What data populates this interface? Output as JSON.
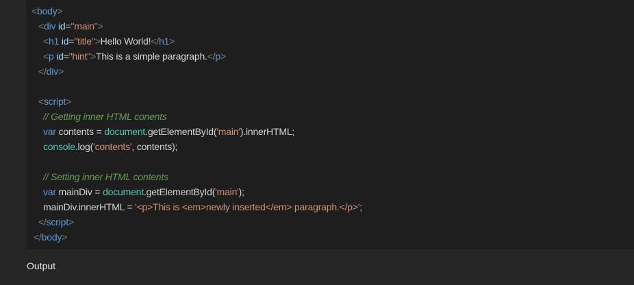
{
  "code": {
    "lines": [
      {
        "indent": "indent-0",
        "tokens": [
          {
            "t": "<",
            "c": "tk-punct"
          },
          {
            "t": "body",
            "c": "tk-tag"
          },
          {
            "t": ">",
            "c": "tk-punct"
          }
        ]
      },
      {
        "indent": "indent-1",
        "tokens": [
          {
            "t": "<",
            "c": "tk-punct"
          },
          {
            "t": "div",
            "c": "tk-tag"
          },
          {
            "t": " ",
            "c": "tk-plain"
          },
          {
            "t": "id",
            "c": "tk-attr"
          },
          {
            "t": "=",
            "c": "tk-text"
          },
          {
            "t": "\"main\"",
            "c": "tk-str"
          },
          {
            "t": ">",
            "c": "tk-punct"
          }
        ]
      },
      {
        "indent": "indent-2",
        "tokens": [
          {
            "t": "<",
            "c": "tk-punct"
          },
          {
            "t": "h1",
            "c": "tk-tag"
          },
          {
            "t": " ",
            "c": "tk-plain"
          },
          {
            "t": "id",
            "c": "tk-attr"
          },
          {
            "t": "=",
            "c": "tk-text"
          },
          {
            "t": "\"title\"",
            "c": "tk-str"
          },
          {
            "t": ">",
            "c": "tk-punct"
          },
          {
            "t": "Hello World!",
            "c": "tk-text"
          },
          {
            "t": "</",
            "c": "tk-punct"
          },
          {
            "t": "h1",
            "c": "tk-tag"
          },
          {
            "t": ">",
            "c": "tk-punct"
          }
        ]
      },
      {
        "indent": "indent-2",
        "tokens": [
          {
            "t": "<",
            "c": "tk-punct"
          },
          {
            "t": "p",
            "c": "tk-tag"
          },
          {
            "t": " ",
            "c": "tk-plain"
          },
          {
            "t": "id",
            "c": "tk-attr"
          },
          {
            "t": "=",
            "c": "tk-text"
          },
          {
            "t": "\"hint\"",
            "c": "tk-str"
          },
          {
            "t": ">",
            "c": "tk-punct"
          },
          {
            "t": "This is a simple paragraph.",
            "c": "tk-text"
          },
          {
            "t": "</",
            "c": "tk-punct"
          },
          {
            "t": "p",
            "c": "tk-tag"
          },
          {
            "t": ">",
            "c": "tk-punct"
          }
        ]
      },
      {
        "indent": "indent-1",
        "tokens": [
          {
            "t": "</",
            "c": "tk-punct"
          },
          {
            "t": "div",
            "c": "tk-tag"
          },
          {
            "t": ">",
            "c": "tk-punct"
          }
        ]
      },
      {
        "indent": "indent-1",
        "tokens": []
      },
      {
        "indent": "indent-1",
        "tokens": [
          {
            "t": "<",
            "c": "tk-punct"
          },
          {
            "t": "script",
            "c": "tk-tag"
          },
          {
            "t": ">",
            "c": "tk-punct"
          }
        ]
      },
      {
        "indent": "indent-2",
        "tokens": [
          {
            "t": "// Getting inner HTML conents",
            "c": "tk-comment"
          }
        ]
      },
      {
        "indent": "indent-2",
        "tokens": [
          {
            "t": "var",
            "c": "tk-kw"
          },
          {
            "t": " contents = ",
            "c": "tk-plain"
          },
          {
            "t": "document",
            "c": "tk-obj"
          },
          {
            "t": ".getElementById(",
            "c": "tk-plain"
          },
          {
            "t": "'main'",
            "c": "tk-str"
          },
          {
            "t": ").innerHTML;",
            "c": "tk-plain"
          }
        ]
      },
      {
        "indent": "indent-2",
        "tokens": [
          {
            "t": "console",
            "c": "tk-obj"
          },
          {
            "t": ".log(",
            "c": "tk-plain"
          },
          {
            "t": "'contents'",
            "c": "tk-str"
          },
          {
            "t": ", contents);",
            "c": "tk-plain"
          }
        ]
      },
      {
        "indent": "indent-2",
        "tokens": []
      },
      {
        "indent": "indent-2",
        "tokens": [
          {
            "t": "// Setting inner HTML contents",
            "c": "tk-comment"
          }
        ]
      },
      {
        "indent": "indent-2",
        "tokens": [
          {
            "t": "var",
            "c": "tk-kw"
          },
          {
            "t": " mainDiv = ",
            "c": "tk-plain"
          },
          {
            "t": "document",
            "c": "tk-obj"
          },
          {
            "t": ".getElementById(",
            "c": "tk-plain"
          },
          {
            "t": "'main'",
            "c": "tk-str"
          },
          {
            "t": ");",
            "c": "tk-plain"
          }
        ]
      },
      {
        "indent": "indent-2",
        "tokens": [
          {
            "t": "mainDiv.innerHTML = ",
            "c": "tk-plain"
          },
          {
            "t": "'<p>This is <em>newly inserted</em> paragraph.</p>'",
            "c": "tk-str"
          },
          {
            "t": ";",
            "c": "tk-plain"
          }
        ]
      },
      {
        "indent": "indent-1",
        "tokens": [
          {
            "t": "</",
            "c": "tk-punct"
          },
          {
            "t": "script",
            "c": "tk-tag"
          },
          {
            "t": ">",
            "c": "tk-punct"
          }
        ]
      },
      {
        "indent": "indent-1b",
        "tokens": [
          {
            "t": "</",
            "c": "tk-punct"
          },
          {
            "t": "body",
            "c": "tk-tag"
          },
          {
            "t": ">",
            "c": "tk-punct"
          }
        ]
      }
    ]
  },
  "output": {
    "label": "Output"
  },
  "colors": {
    "page_background": "#262626",
    "code_background": "#1e1e1e",
    "tag": "#569cd6",
    "attribute": "#9cdcfe",
    "string": "#ce9178",
    "comment": "#6a9955",
    "object": "#4ec9b0",
    "text": "#d4d4d4"
  }
}
